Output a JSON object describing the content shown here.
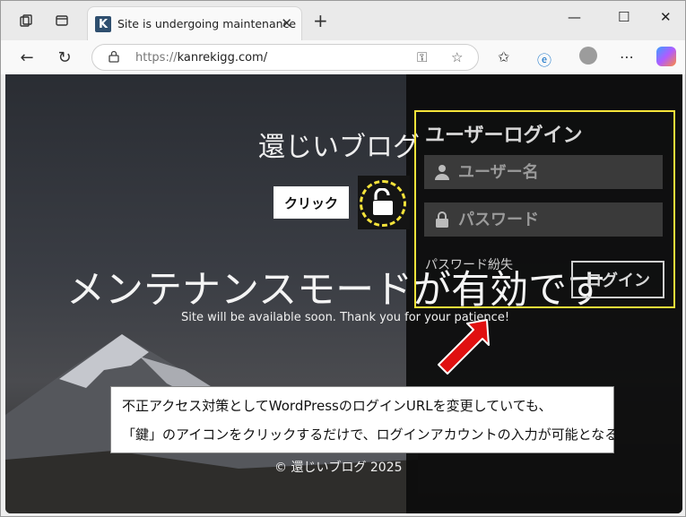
{
  "browser": {
    "tab_title": "Site is undergoing maintenance",
    "tab_favicon_letter": "K",
    "url_protocol": "https://",
    "url_rest": "kanrekigg.com/",
    "icons": [
      "workspaces-icon",
      "tab-actions-icon",
      "close-icon",
      "new-tab-icon",
      "minimize-icon",
      "maximize-icon",
      "window-close-icon",
      "back-icon",
      "refresh-icon",
      "lock-icon",
      "key-icon",
      "favorite-star-icon",
      "favorites-icon",
      "e-icon",
      "profile-icon",
      "more-icon",
      "copilot-icon"
    ]
  },
  "page": {
    "site_title": "還じいブログ",
    "click_label": "クリック",
    "maintenance_heading": "メンテナンスモードが有効です",
    "maintenance_sub": "Site will be available soon. Thank you for your patience!",
    "footer": "© 還じいブログ 2025"
  },
  "login": {
    "title": "ユーザーログイン",
    "username_placeholder": "ユーザー名",
    "password_placeholder": "パスワード",
    "lost_password": "パスワード紛失",
    "login_button": "ログイン"
  },
  "annotation": {
    "line1": "不正アクセス対策としてWordPressのログインURLを変更していても、",
    "line2": "「鍵」のアイコンをクリックするだけで、ログインアカウントの入力が可能となる"
  },
  "colors": {
    "highlight": "#f5e33a",
    "arrow": "#e01010"
  }
}
